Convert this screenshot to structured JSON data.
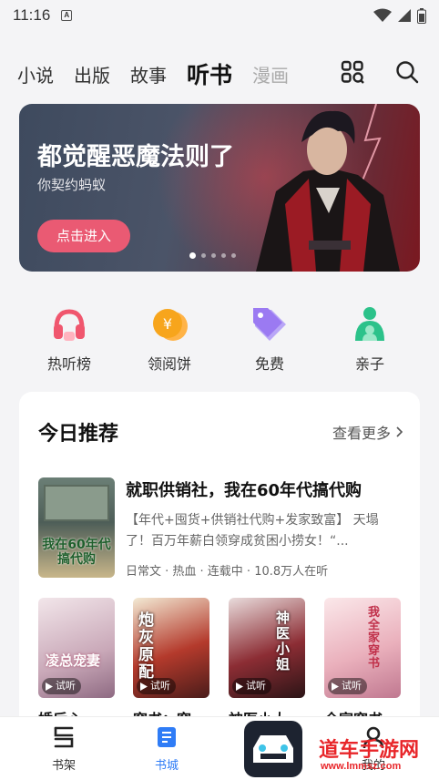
{
  "status_bar": {
    "time": "11:16",
    "notification_glyph": "A"
  },
  "tabs": [
    "小说",
    "出版",
    "故事",
    "听书",
    "漫画"
  ],
  "active_tab": "听书",
  "banner": {
    "title": "都觉醒恶魔法则了",
    "subtitle": "你契约蚂蚁",
    "button": "点击进入"
  },
  "quick_entries": [
    {
      "label": "热听榜",
      "icon": "headphones-icon",
      "color": "#f0566e"
    },
    {
      "label": "领阅饼",
      "icon": "coin-icon",
      "color": "#f7a51c"
    },
    {
      "label": "免费",
      "icon": "tag-icon",
      "color": "#9b7af2"
    },
    {
      "label": "亲子",
      "icon": "parent-child-icon",
      "color": "#2cc28a"
    }
  ],
  "recommend": {
    "title": "今日推荐",
    "more": "查看更多",
    "featured": {
      "title": "就职供销社，我在60年代搞代购",
      "desc": "【年代+囤货+供销社代购+发家致富】 天塌了！百万年薪白领穿成贫困小捞女！“...",
      "meta": "日常文 · 热血 · 连载中 · 10.8万人在听",
      "cover_text": "我在60年代搞代购"
    },
    "try_label": "试听",
    "books": [
      {
        "cover_text": "凌总宠妻",
        "title_peek": "婚后心"
      },
      {
        "cover_text": "炮灰原配",
        "title_peek": "穿书：穿"
      },
      {
        "cover_text": "神医小姐",
        "title_peek": "神医小大"
      },
      {
        "cover_text": "我全家穿书",
        "title_peek": "全家穿书"
      }
    ]
  },
  "bottom_nav": [
    {
      "label": "书架"
    },
    {
      "label": "书城"
    },
    {
      "label": "我的"
    }
  ],
  "active_bottom": "书城",
  "watermark": {
    "text": "道车手游网",
    "url": "www.lmmsz.com"
  }
}
